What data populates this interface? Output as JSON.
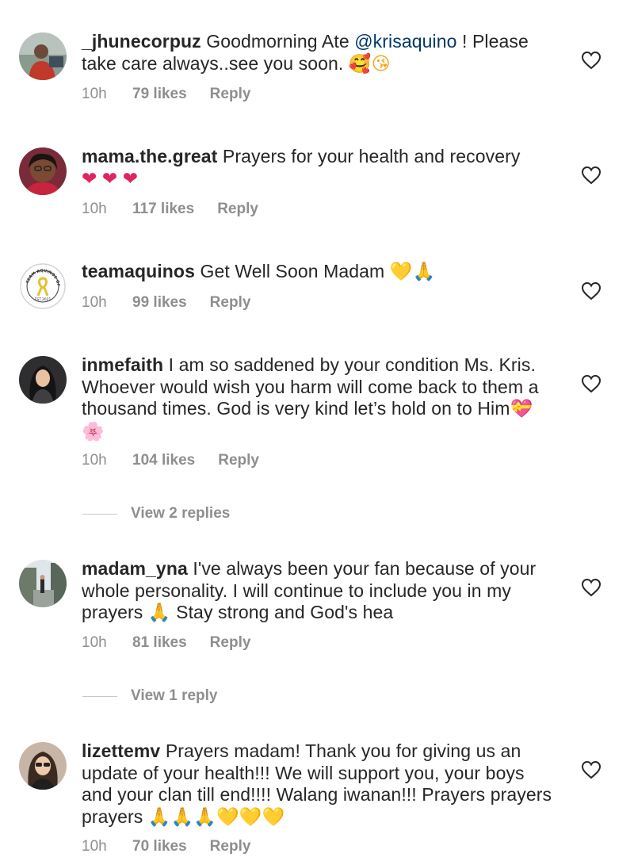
{
  "comments": [
    {
      "username": "_jhunecorpuz",
      "segments": [
        " Goodmorning Ate ",
        "@krisaquino",
        " ! Please take care always..see you soon. "
      ],
      "emojis": [
        "🥰",
        "😘"
      ],
      "time": "10h",
      "likes": "79 likes",
      "reply": "Reply"
    },
    {
      "username": "mama.the.great",
      "segments": [
        " Prayers for your health and recovery "
      ],
      "emojis": [
        "❤",
        "❤",
        "❤"
      ],
      "time": "10h",
      "likes": "117 likes",
      "reply": "Reply"
    },
    {
      "username": "teamaquinos",
      "segments": [
        " Get Well Soon Madam "
      ],
      "emojis": [
        "💛",
        "🙏"
      ],
      "time": "10h",
      "likes": "99 likes",
      "reply": "Reply",
      "avatar_text": [
        "TEAM AQUINOS OFFICIAL",
        "EST.2021"
      ]
    },
    {
      "username": "inmefaith",
      "segments": [
        " I am so saddened by your condition Ms. Kris. Whoever would wish you harm will come back to them a thousand times. God is very kind let’s hold on to Him"
      ],
      "emojis": [
        "💝",
        "🌸"
      ],
      "time": "10h",
      "likes": "104 likes",
      "reply": "Reply",
      "view_replies": "View 2 replies"
    },
    {
      "username": "madam_yna",
      "segments": [
        " I've always been your fan because of your whole personality. I will continue to include you in my prayers ",
        " Stay strong and God's hea"
      ],
      "emojis": [
        "🙏"
      ],
      "time": "10h",
      "likes": "81 likes",
      "reply": "Reply",
      "view_replies": "View 1 reply"
    },
    {
      "username": "lizettemv",
      "segments": [
        " Prayers madam! Thank you for giving us an update of your health!!! We will support you, your boys and your clan till end!!!! Walang iwanan!!! Prayers prayers prayers "
      ],
      "emojis": [
        "🙏",
        "🙏",
        "🙏",
        "💛",
        "💛",
        "💛"
      ],
      "time": "10h",
      "likes": "70 likes",
      "reply": "Reply"
    }
  ],
  "colors": {
    "text": "#262626",
    "meta": "#8e8e8e",
    "mention": "#00376b",
    "divider": "#c7c7c7"
  },
  "icons": {
    "like": "heart-outline-icon"
  }
}
